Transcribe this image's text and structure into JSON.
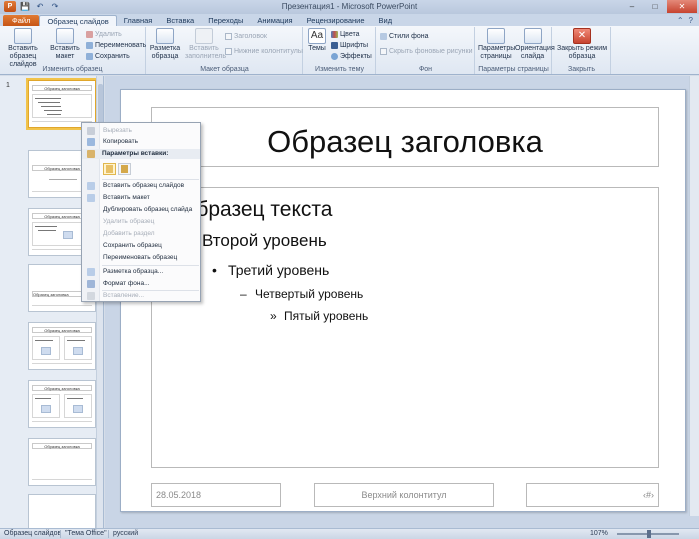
{
  "window": {
    "title": "Презентация1 - Microsoft PowerPoint",
    "min_label": "–",
    "max_label": "□",
    "close_label": "✕"
  },
  "qat": {
    "app_label": "P",
    "save_label": "💾",
    "undo_label": "↶",
    "redo_label": "↷"
  },
  "tabs": [
    {
      "label": "Файл"
    },
    {
      "label": "Образец слайдов"
    },
    {
      "label": "Главная"
    },
    {
      "label": "Вставка"
    },
    {
      "label": "Переходы"
    },
    {
      "label": "Анимация"
    },
    {
      "label": "Рецензирование"
    },
    {
      "label": "Вид"
    }
  ],
  "tabs_right": {
    "min_label": "⌃",
    "help_label": "?"
  },
  "ribbon": {
    "edit_group": {
      "label": "Изменить образец",
      "insert_master": "Вставить образец слайдов",
      "insert_layout": "Вставить макет",
      "delete": "Удалить",
      "rename": "Переименовать",
      "preserve": "Сохранить"
    },
    "layout_group": {
      "label": "Макет образца",
      "master_layout": "Разметка образца",
      "insert_placeholder": "Вставить заполнитель",
      "title": "Заголовок",
      "footers": "Нижние колонтитулы"
    },
    "theme_group": {
      "label": "Изменить тему",
      "themes": "Темы",
      "colors": "Цвета",
      "fonts": "Шрифты",
      "effects": "Эффекты"
    },
    "background_group": {
      "label": "Фон",
      "styles": "Стили фона",
      "hide_graphics": "Скрыть фоновые рисунки"
    },
    "page_group": {
      "label": "Параметры страницы",
      "setup": "Параметры страницы",
      "orientation": "Ориентация слайда"
    },
    "close_group": {
      "label": "Закрыть",
      "close": "Закрыть режим образца"
    }
  },
  "thumbnails": [
    {
      "num": "1",
      "title": "Образец заголовка",
      "kind": "master"
    },
    {
      "num": "",
      "title": "Образец заголовка",
      "kind": "title"
    },
    {
      "num": "",
      "title": "Образец заголовка",
      "kind": "content"
    },
    {
      "num": "",
      "title": "Образец заголовка",
      "kind": "section"
    },
    {
      "num": "",
      "title": "Образец заголовка",
      "kind": "two"
    },
    {
      "num": "",
      "title": "Образец заголовка",
      "kind": "comparison"
    },
    {
      "num": "",
      "title": "Образец заголовка",
      "kind": "titleonly"
    },
    {
      "num": "",
      "title": "",
      "kind": "blank"
    }
  ],
  "slide": {
    "title": "Образец заголовка",
    "level1": "Образец текста",
    "level2": "Второй уровень",
    "level3": "Третий уровень",
    "level4": "Четвертый уровень",
    "level5": "Пятый уровень",
    "bullet2": "•",
    "bullet3": "•",
    "bullet4": "–",
    "bullet5": "»",
    "date": "28.05.2018",
    "footer": "Верхний колонтитул",
    "slide_num": "‹#›"
  },
  "context_menu": {
    "cut": "Вырезать",
    "copy": "Копировать",
    "paste_header": "Параметры вставки:",
    "insert_master": "Вставить образец слайдов",
    "insert_layout": "Вставить макет",
    "duplicate": "Дублировать образец слайда",
    "delete": "Удалить образец",
    "add_section": "Добавить раздел",
    "preserve": "Сохранить образец",
    "rename": "Переименовать образец",
    "master_layout": "Разметка образца...",
    "format_bg": "Формат фона...",
    "animation": "Вставление..."
  },
  "status": {
    "view": "Образец слайдов",
    "theme": "\"Тема Office\"",
    "language": "русский",
    "zoom": "107%"
  },
  "colors": {
    "accent_file_tab": "#d2631f",
    "ribbon_bg": "#e8eef6",
    "selection": "#f1c34a",
    "close_red": "#c6432f"
  }
}
